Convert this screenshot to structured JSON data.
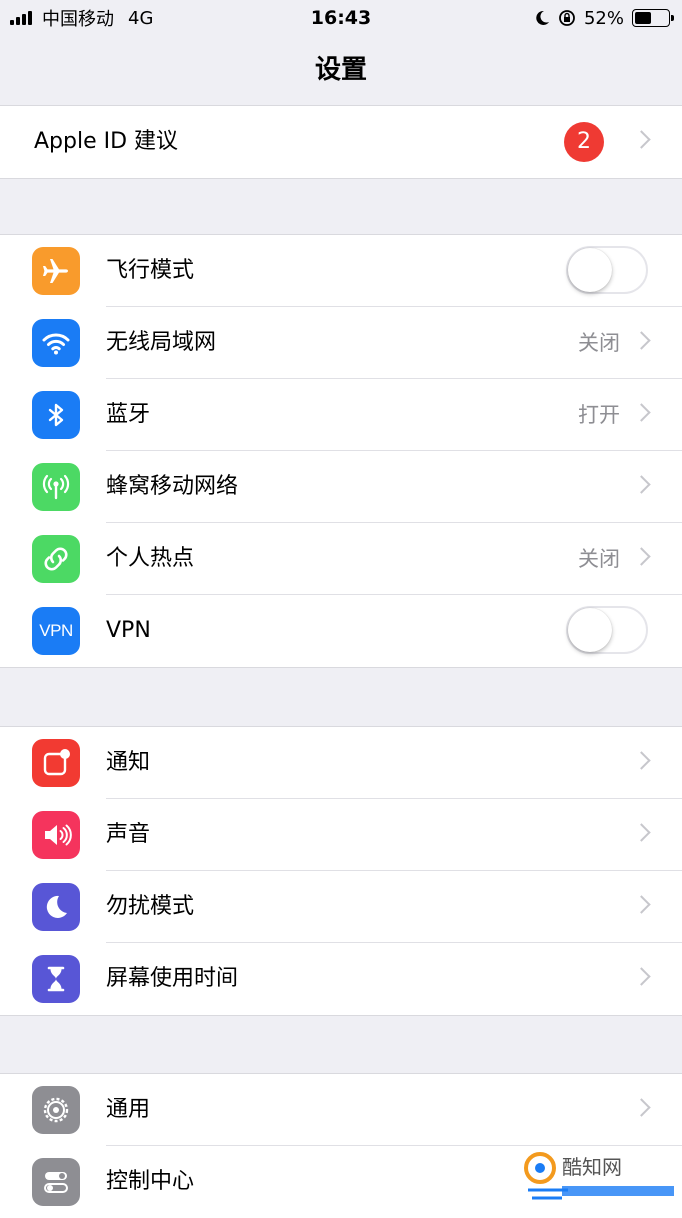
{
  "status_bar": {
    "carrier": "中国移动",
    "network": "4G",
    "time": "16:43",
    "battery": "52%",
    "battery_level": 0.52
  },
  "nav": {
    "title": "设置"
  },
  "apple_id": {
    "label": "Apple ID 建议",
    "badge": "2"
  },
  "connectivity": [
    {
      "label": "飞行模式",
      "icon": "airplane-icon",
      "color": "#f99b2c",
      "toggle": false
    },
    {
      "label": "无线局域网",
      "icon": "wifi-icon",
      "color": "#1a7cf5",
      "value": "关闭"
    },
    {
      "label": "蓝牙",
      "icon": "bluetooth-icon",
      "color": "#1a7cf5",
      "value": "打开"
    },
    {
      "label": "蜂窝移动网络",
      "icon": "antenna-icon",
      "color": "#4cd964"
    },
    {
      "label": "个人热点",
      "icon": "hotspot-link-icon",
      "color": "#4cd964",
      "value": "关闭"
    },
    {
      "label": "VPN",
      "icon": "vpn-icon",
      "icon_text": "VPN",
      "color": "#1a7cf5",
      "toggle": false
    }
  ],
  "alerts": [
    {
      "label": "通知",
      "icon": "notification-icon",
      "color": "#f23a32"
    },
    {
      "label": "声音",
      "icon": "speaker-icon",
      "color": "#f5345d"
    },
    {
      "label": "勿扰模式",
      "icon": "moon-icon",
      "color": "#5856d6"
    },
    {
      "label": "屏幕使用时间",
      "icon": "hourglass-icon",
      "color": "#5856d6"
    }
  ],
  "general": [
    {
      "label": "通用",
      "icon": "gear-icon",
      "color": "#8e8e93"
    },
    {
      "label": "控制中心",
      "icon": "switches-icon",
      "color": "#8e8e93"
    }
  ],
  "watermark": {
    "text": "酷知网"
  }
}
